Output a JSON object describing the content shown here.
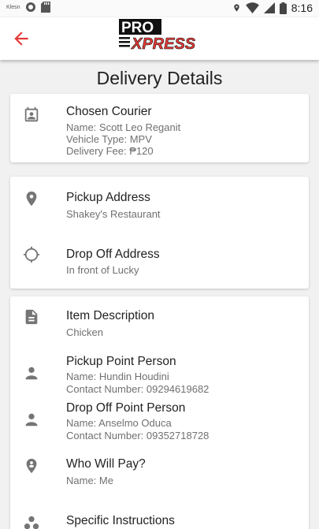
{
  "status_bar": {
    "time": "8:16",
    "left_icons": [
      "carrier-logo-icon",
      "circle-icon",
      "sd-card-icon"
    ],
    "right_icons": [
      "location-icon",
      "wifi-icon",
      "signal-icon",
      "battery-icon"
    ],
    "carrier_text": "Klesn"
  },
  "app_bar": {
    "back_icon": "arrow-left-icon",
    "logo_pro": "PRO",
    "logo_xpress": "XPRESS",
    "accent_color": "#e53935"
  },
  "page": {
    "title": "Delivery Details"
  },
  "courier": {
    "title": "Chosen Courier",
    "name": "Name: Scott Leo Reganit",
    "vehicle": "Vehicle Type: MPV",
    "fee": "Delivery Fee: ₱120"
  },
  "addresses": {
    "pickup_title": "Pickup Address",
    "pickup_value": "Shakey's Restaurant",
    "dropoff_title": "Drop Off Address",
    "dropoff_value": "In front of Lucky"
  },
  "details": {
    "item_title": "Item Description",
    "item_value": "Chicken",
    "pickup_person_title": "Pickup Point Person",
    "pickup_person_name": "Name: Hundin Houdini",
    "pickup_person_contact": "Contact Number: 09294619682",
    "dropoff_person_title": "Drop Off Point Person",
    "dropoff_person_name": "Name: Anselmo Oduca",
    "dropoff_person_contact": "Contact Number: 09352718728",
    "payer_title": "Who Will Pay?",
    "payer_value": "Name: Me",
    "instructions_title": "Specific Instructions"
  },
  "colors": {
    "icon_gray": "#757575",
    "background": "#f1f1f1",
    "brand_red": "#e53935"
  }
}
